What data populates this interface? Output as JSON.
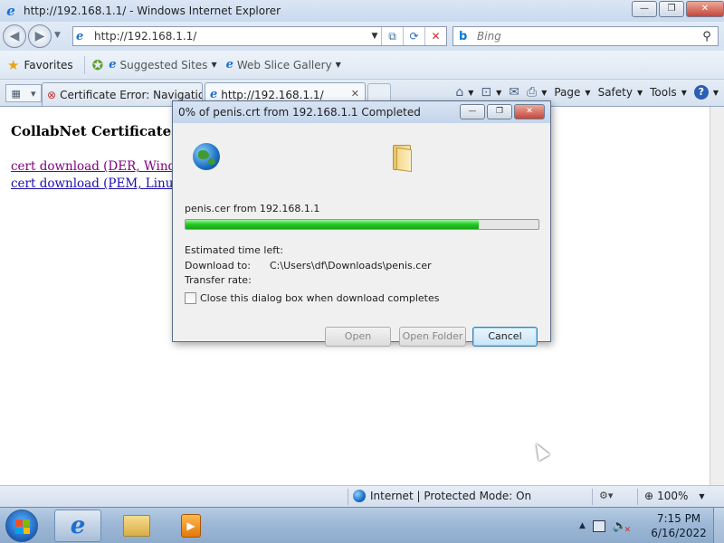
{
  "window": {
    "title": "http://192.168.1.1/ - Windows Internet Explorer",
    "buttons": {
      "minimize": "—",
      "maximize": "❐",
      "close": "✕"
    }
  },
  "address_bar": {
    "url": "http://192.168.1.1/",
    "search_placeholder": "Bing"
  },
  "favorites_bar": {
    "favorites_label": "Favorites",
    "links": [
      {
        "label": "Suggested Sites"
      },
      {
        "label": "Web Slice Gallery"
      }
    ]
  },
  "tabs": [
    {
      "label": "Certificate Error: Navigatio...",
      "icon": "certificate-error-icon"
    },
    {
      "label": "http://192.168.1.1/",
      "icon": "ie-page-icon",
      "active": true
    }
  ],
  "command_bar": {
    "page": "Page",
    "safety": "Safety",
    "tools": "Tools",
    "help": "?"
  },
  "page": {
    "title": "CollabNet Certificates",
    "links": [
      {
        "label": "cert download (DER, Windows)",
        "visited": true
      },
      {
        "label": "cert download (PEM, Linux)",
        "visited": false
      }
    ]
  },
  "download_dialog": {
    "title": "0% of penis.crt from 192.168.1.1 Completed",
    "file_line": "penis.cer from 192.168.1.1",
    "progress": 0.83,
    "estimated_time_label": "Estimated time left:",
    "download_to_label": "Download to:",
    "download_to_value": "C:\\Users\\df\\Downloads\\penis.cer",
    "transfer_rate_label": "Transfer rate:",
    "close_checkbox_label": "Close this dialog box when download completes",
    "close_checkbox_checked": false,
    "buttons": {
      "open": "Open",
      "open_folder": "Open Folder",
      "cancel": "Cancel"
    }
  },
  "status_bar": {
    "zone": "Internet | Protected Mode: On",
    "zoom": "100%"
  },
  "taskbar": {
    "clock_time": "7:15 PM",
    "clock_date": "6/16/2022"
  },
  "colors": {
    "accent": "#1c6fd0",
    "progress": "#23c623",
    "visited_link": "#800080",
    "link": "#1a0dab"
  }
}
